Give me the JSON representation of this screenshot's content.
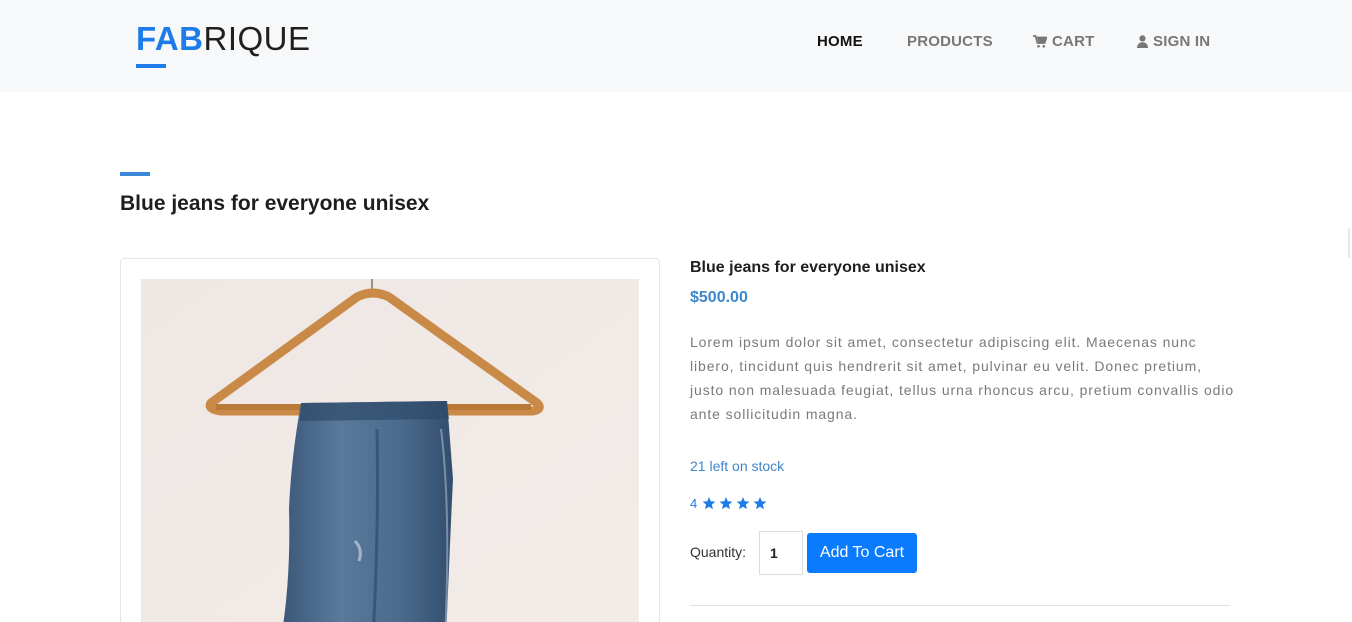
{
  "brand": {
    "part1": "FAB",
    "part2": "RIQUE",
    "accent_color": "#1d7ce8"
  },
  "nav": {
    "home": "HOME",
    "products": "PRODUCTS",
    "cart": "CART",
    "signin": "SIGN IN",
    "cart_icon": "shopping-cart-icon",
    "signin_icon": "user-icon"
  },
  "page": {
    "title": "Blue jeans for everyone unisex"
  },
  "product": {
    "name": "Blue jeans for everyone unisex",
    "price": "$500.00",
    "description": "Lorem ipsum dolor sit amet, consectetur adipiscing elit. Maecenas nunc libero, tincidunt quis hendrerit sit amet, pulvinar eu velit. Donec pretium, justo non malesuada feugiat, tellus urna rhoncus arcu, pretium convallis odio ante sollicitudin magna.",
    "stock": "21 left on stock",
    "rating": "4",
    "rating_stars": 4,
    "image_alt": "Blue jeans hanging on a wooden hanger"
  },
  "cart_form": {
    "quantity_label": "Quantity:",
    "quantity_value": "1",
    "add_button": "Add To Cart",
    "button_color": "#0a7bff"
  }
}
